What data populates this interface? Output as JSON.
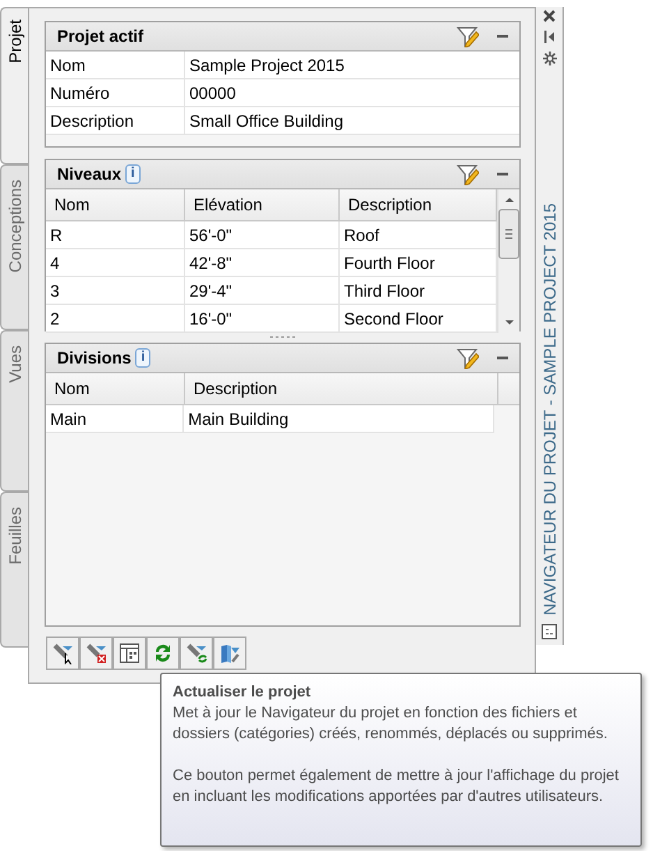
{
  "side_tabs": [
    {
      "label": "Projet",
      "selected": true
    },
    {
      "label": "Conceptions",
      "selected": false
    },
    {
      "label": "Vues",
      "selected": false
    },
    {
      "label": "Feuilles",
      "selected": false
    }
  ],
  "project_panel": {
    "title": "Projet actif",
    "rows": [
      {
        "label": "Nom",
        "value": "Sample Project 2015"
      },
      {
        "label": "Numéro",
        "value": "00000"
      },
      {
        "label": "Description",
        "value": "Small Office Building"
      }
    ]
  },
  "levels_panel": {
    "title": "Niveaux",
    "info": "i",
    "columns": [
      "Nom",
      "Elévation",
      "Description"
    ],
    "rows": [
      [
        "R",
        "56'-0\"",
        "Roof"
      ],
      [
        "4",
        "42'-8\"",
        "Fourth Floor"
      ],
      [
        "3",
        "29'-4\"",
        "Third Floor"
      ],
      [
        "2",
        "16'-0\"",
        "Second Floor"
      ]
    ]
  },
  "divisions_panel": {
    "title": "Divisions",
    "info": "i",
    "columns": [
      "Nom",
      "Description"
    ],
    "rows": [
      [
        "Main",
        "Main Building"
      ]
    ]
  },
  "palette_title": "NAVIGATEUR DU PROJET - SAMPLE PROJECT 2015",
  "tooltip": {
    "title": "Actualiser le projet",
    "paragraphs": [
      "Met à jour le Navigateur du projet en fonction des fichiers et dossiers (catégories) créés, renommés, déplacés ou supprimés.",
      "Ce bouton permet également de mettre à jour l'affichage du projet en incluant les modifications apportées par d'autres utilisateurs."
    ]
  }
}
